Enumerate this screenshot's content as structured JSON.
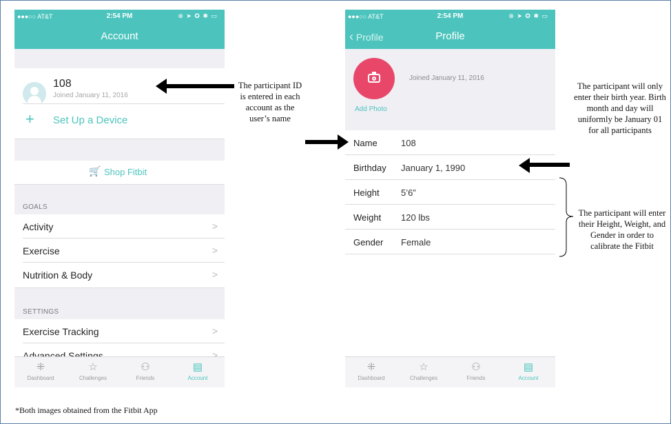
{
  "left_phone": {
    "status": {
      "carrier": "●●●○○ AT&T",
      "time": "2:54 PM",
      "icons": "⊕ ➤ ✪ ✱ ▭"
    },
    "nav_title": "Account",
    "profile": {
      "name": "108",
      "joined": "Joined January 11, 2016"
    },
    "setup_label": "Set Up a Device",
    "shop_label": "Shop Fitbit",
    "goals_header": "GOALS",
    "goals": [
      {
        "label": "Activity"
      },
      {
        "label": "Exercise"
      },
      {
        "label": "Nutrition & Body"
      }
    ],
    "settings_header": "SETTINGS",
    "settings": [
      {
        "label": "Exercise Tracking"
      },
      {
        "label": "Advanced Settings"
      }
    ]
  },
  "right_phone": {
    "status": {
      "carrier": "●●●○○ AT&T",
      "time": "2:54 PM",
      "icons": "⊕ ➤ ✪ ✱ ▭"
    },
    "back_label": "Profile",
    "nav_title": "Profile",
    "joined": "Joined January 11, 2016",
    "add_photo": "Add Photo",
    "fields": [
      {
        "key": "Name",
        "value": "108"
      },
      {
        "key": "Birthday",
        "value": "January 1, 1990"
      },
      {
        "key": "Height",
        "value": "5’6”"
      },
      {
        "key": "Weight",
        "value": "120 lbs"
      },
      {
        "key": "Gender",
        "value": "Female"
      }
    ]
  },
  "tabbar": {
    "tabs": [
      {
        "label": "Dashboard",
        "icon": "dashboard-icon"
      },
      {
        "label": "Challenges",
        "icon": "star-badge-icon"
      },
      {
        "label": "Friends",
        "icon": "friends-icon"
      },
      {
        "label": "Account",
        "icon": "account-card-icon"
      }
    ]
  },
  "annotations": {
    "participant_id": "The participant ID is entered in each account as the user’s name",
    "birth_year": "The participant will only enter their birth year.  Birth month and day will uniformly be January 01 for all participants",
    "calibration": "The participant will enter their Height, Weight, and Gender in order to calibrate the Fitbit"
  },
  "footnote": "*Both images obtained from the Fitbit App",
  "colors": {
    "accent": "#4cc4bd",
    "camera": "#e8476a"
  }
}
